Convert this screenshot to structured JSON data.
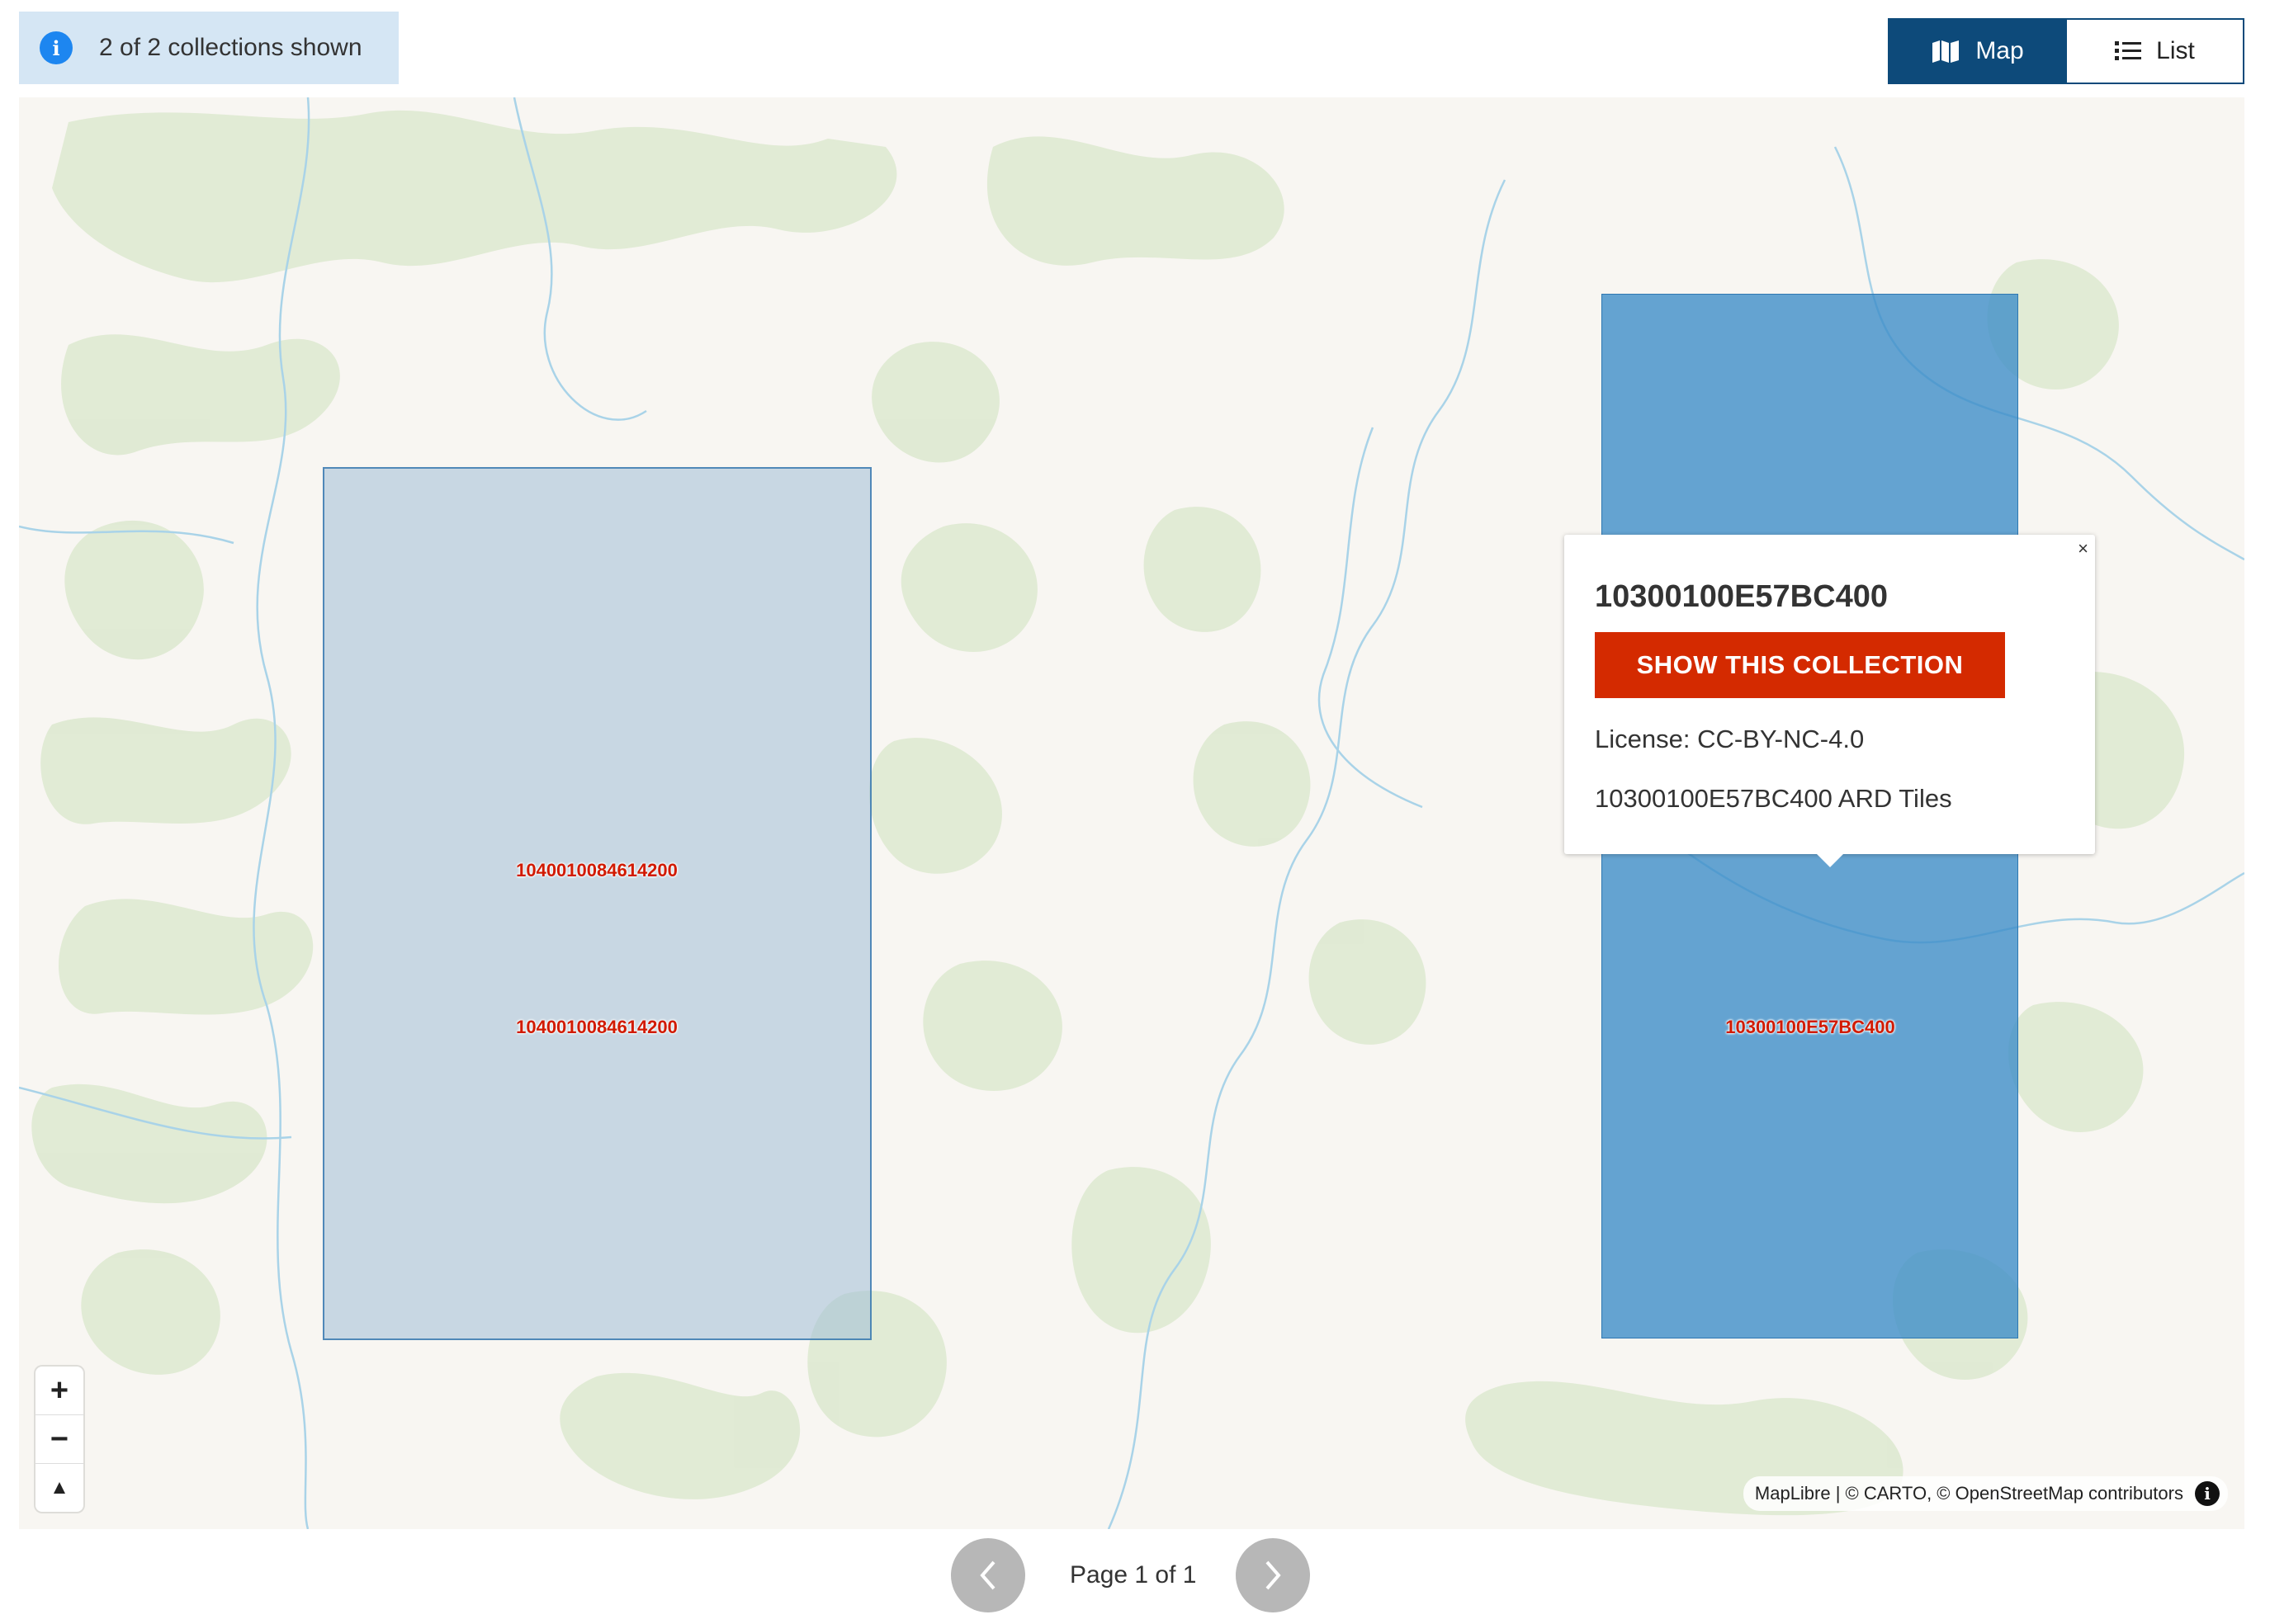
{
  "info": {
    "icon": "info-icon",
    "text": "2 of 2 collections shown"
  },
  "view_toggle": {
    "map_label": "Map",
    "list_label": "List",
    "map_icon": "map-icon",
    "list_icon": "list-icon",
    "active": "Map"
  },
  "map": {
    "footprints": [
      {
        "id": "1040010084614200",
        "labels": [
          "1040010084614200",
          "1040010084614200"
        ]
      },
      {
        "id": "10300100E57BC400",
        "labels": [
          "10300100E57BC400"
        ]
      }
    ],
    "popup": {
      "title": "10300100E57BC400",
      "button_label": "SHOW THIS COLLECTION",
      "license": "License: CC-BY-NC-4.0",
      "tiles": "10300100E57BC400 ARD Tiles",
      "close": "×"
    },
    "zoom": {
      "in": "+",
      "out": "−",
      "compass": "▲"
    },
    "attribution": "MapLibre | © CARTO, © OpenStreetMap contributors",
    "attribution_icon": "i"
  },
  "pager": {
    "text": "Page 1 of 1",
    "prev": "‹",
    "next": "›"
  },
  "colors": {
    "accent": "#0d4a7a",
    "danger": "#d42a00",
    "footprint_dark": "#3a8cc8",
    "label": "#d11a00"
  }
}
